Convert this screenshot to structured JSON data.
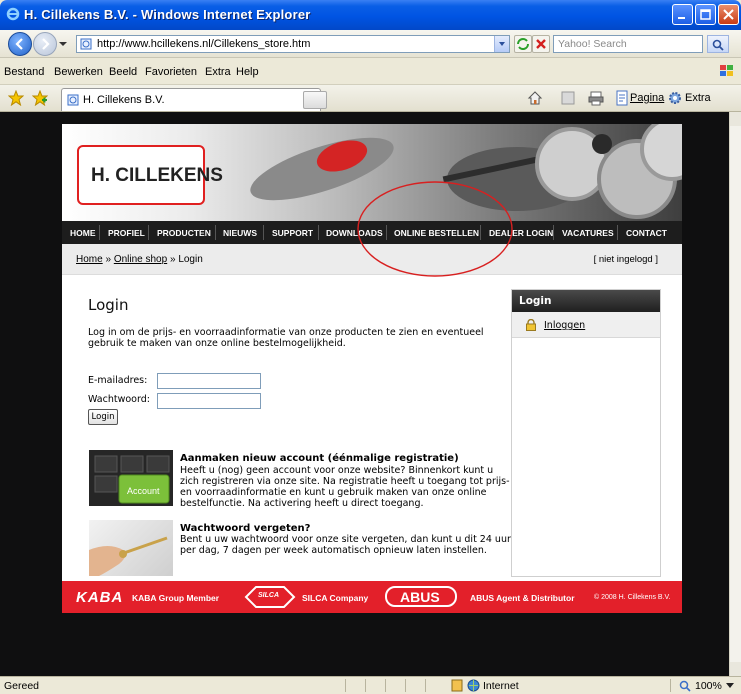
{
  "window": {
    "title": "H. Cillekens B.V. - Windows Internet Explorer",
    "url": "http://www.hcillekens.nl/Cillekens_store.htm",
    "search_placeholder": "Yahoo! Search"
  },
  "menu": [
    "Bestand",
    "Bewerken",
    "Beeld",
    "Favorieten",
    "Extra",
    "Help"
  ],
  "favbar": {
    "tab_label": "H. Cillekens B.V.",
    "pagina_label": "Pagina",
    "extra_label": "Extra"
  },
  "site": {
    "logo": "H. CILLEKENS",
    "nav": [
      "HOME",
      "PROFIEL",
      "PRODUCTEN",
      "NIEUWS",
      "SUPPORT",
      "DOWNLOADS",
      "ONLINE BESTELLEN",
      "DEALER LOGIN",
      "VACATURES",
      "CONTACT"
    ],
    "breadcrumb": {
      "home": "Home",
      "sep": "»",
      "shop": "Online shop",
      "current": "Login"
    },
    "login_status": "[ niet ingelogd ]",
    "page_title": "Login",
    "intro": "Log in om de prijs- en voorraadinformatie van onze producten te zien en eventueel gebruik te maken van onze online bestelmogelijkheid.",
    "email_label": "E-mailadres:",
    "password_label": "Wachtwoord:",
    "login_button": "Login",
    "account_image_text": "Account",
    "new_account": {
      "title": "Aanmaken nieuw account (éénmalige registratie)",
      "text": "Heeft u (nog) geen account voor onze website? Binnenkort kunt u zich registreren via onze site. Na registratie heeft u toegang tot prijs- en voorraadinformatie en kunt u gebruik maken van onze online bestelfunctie. Na activering heeft u direct toegang."
    },
    "forgot": {
      "title": "Wachtwoord vergeten?",
      "text": "Bent u uw wachtwoord voor onze site vergeten, dan kunt u dit 24 uur per dag, 7 dagen per week automatisch opnieuw laten instellen."
    },
    "sidebar": {
      "title": "Login",
      "link": "Inloggen"
    },
    "footer": {
      "kaba_logo": "KABA",
      "kaba": "KABA Group Member",
      "silca_logo": "SILCA",
      "silca": "SILCA Company",
      "abus_logo": "ABUS",
      "abus": "ABUS Agent & Distributor",
      "copyright": "© 2008 H. Cillekens B.V."
    }
  },
  "status": {
    "text": "Gereed",
    "zone": "Internet",
    "zoom": "100%"
  },
  "colors": {
    "brand_red": "#e3202a",
    "nav_bg": "#1d1d1d",
    "ie_blue": "#0054e3"
  }
}
